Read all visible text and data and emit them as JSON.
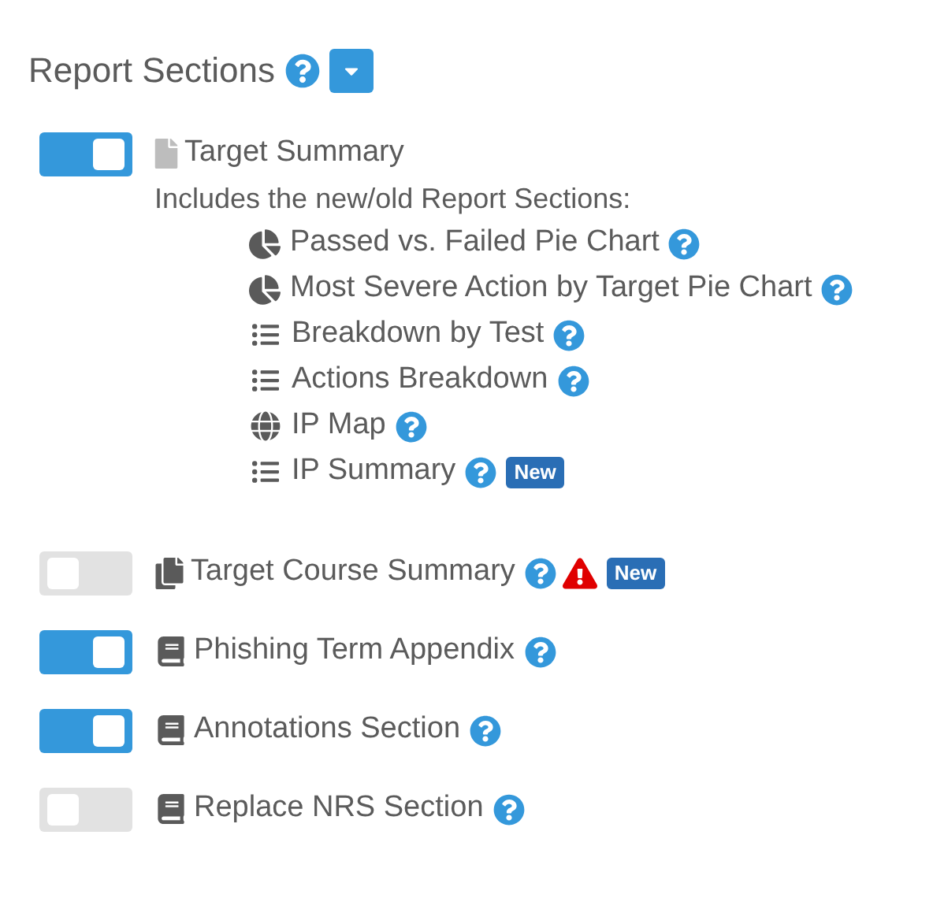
{
  "heading": "Report Sections",
  "sections": [
    {
      "kind": "file",
      "label": "Target Summary",
      "on": true,
      "help": false,
      "warning": false,
      "description": "Includes the new/old Report Sections:",
      "children": [
        {
          "kind": "pie",
          "label": "Passed vs. Failed Pie Chart"
        },
        {
          "kind": "pie",
          "label": "Most Severe Action by Target Pie Chart"
        },
        {
          "kind": "list",
          "label": "Breakdown by Test"
        },
        {
          "kind": "list",
          "label": "Actions Breakdown"
        },
        {
          "kind": "globe",
          "label": "IP Map"
        },
        {
          "kind": "list",
          "label": "IP Summary",
          "badge": "New"
        }
      ]
    },
    {
      "kind": "files",
      "label": "Target Course Summary",
      "on": false,
      "help": true,
      "warning": true,
      "badge": "New"
    },
    {
      "kind": "book",
      "label": "Phishing Term Appendix",
      "on": true,
      "help": true,
      "warning": false
    },
    {
      "kind": "book",
      "label": "Annotations Section",
      "on": true,
      "help": true,
      "warning": false
    },
    {
      "kind": "book",
      "label": "Replace NRS Section",
      "on": false,
      "help": true,
      "warning": false
    }
  ]
}
